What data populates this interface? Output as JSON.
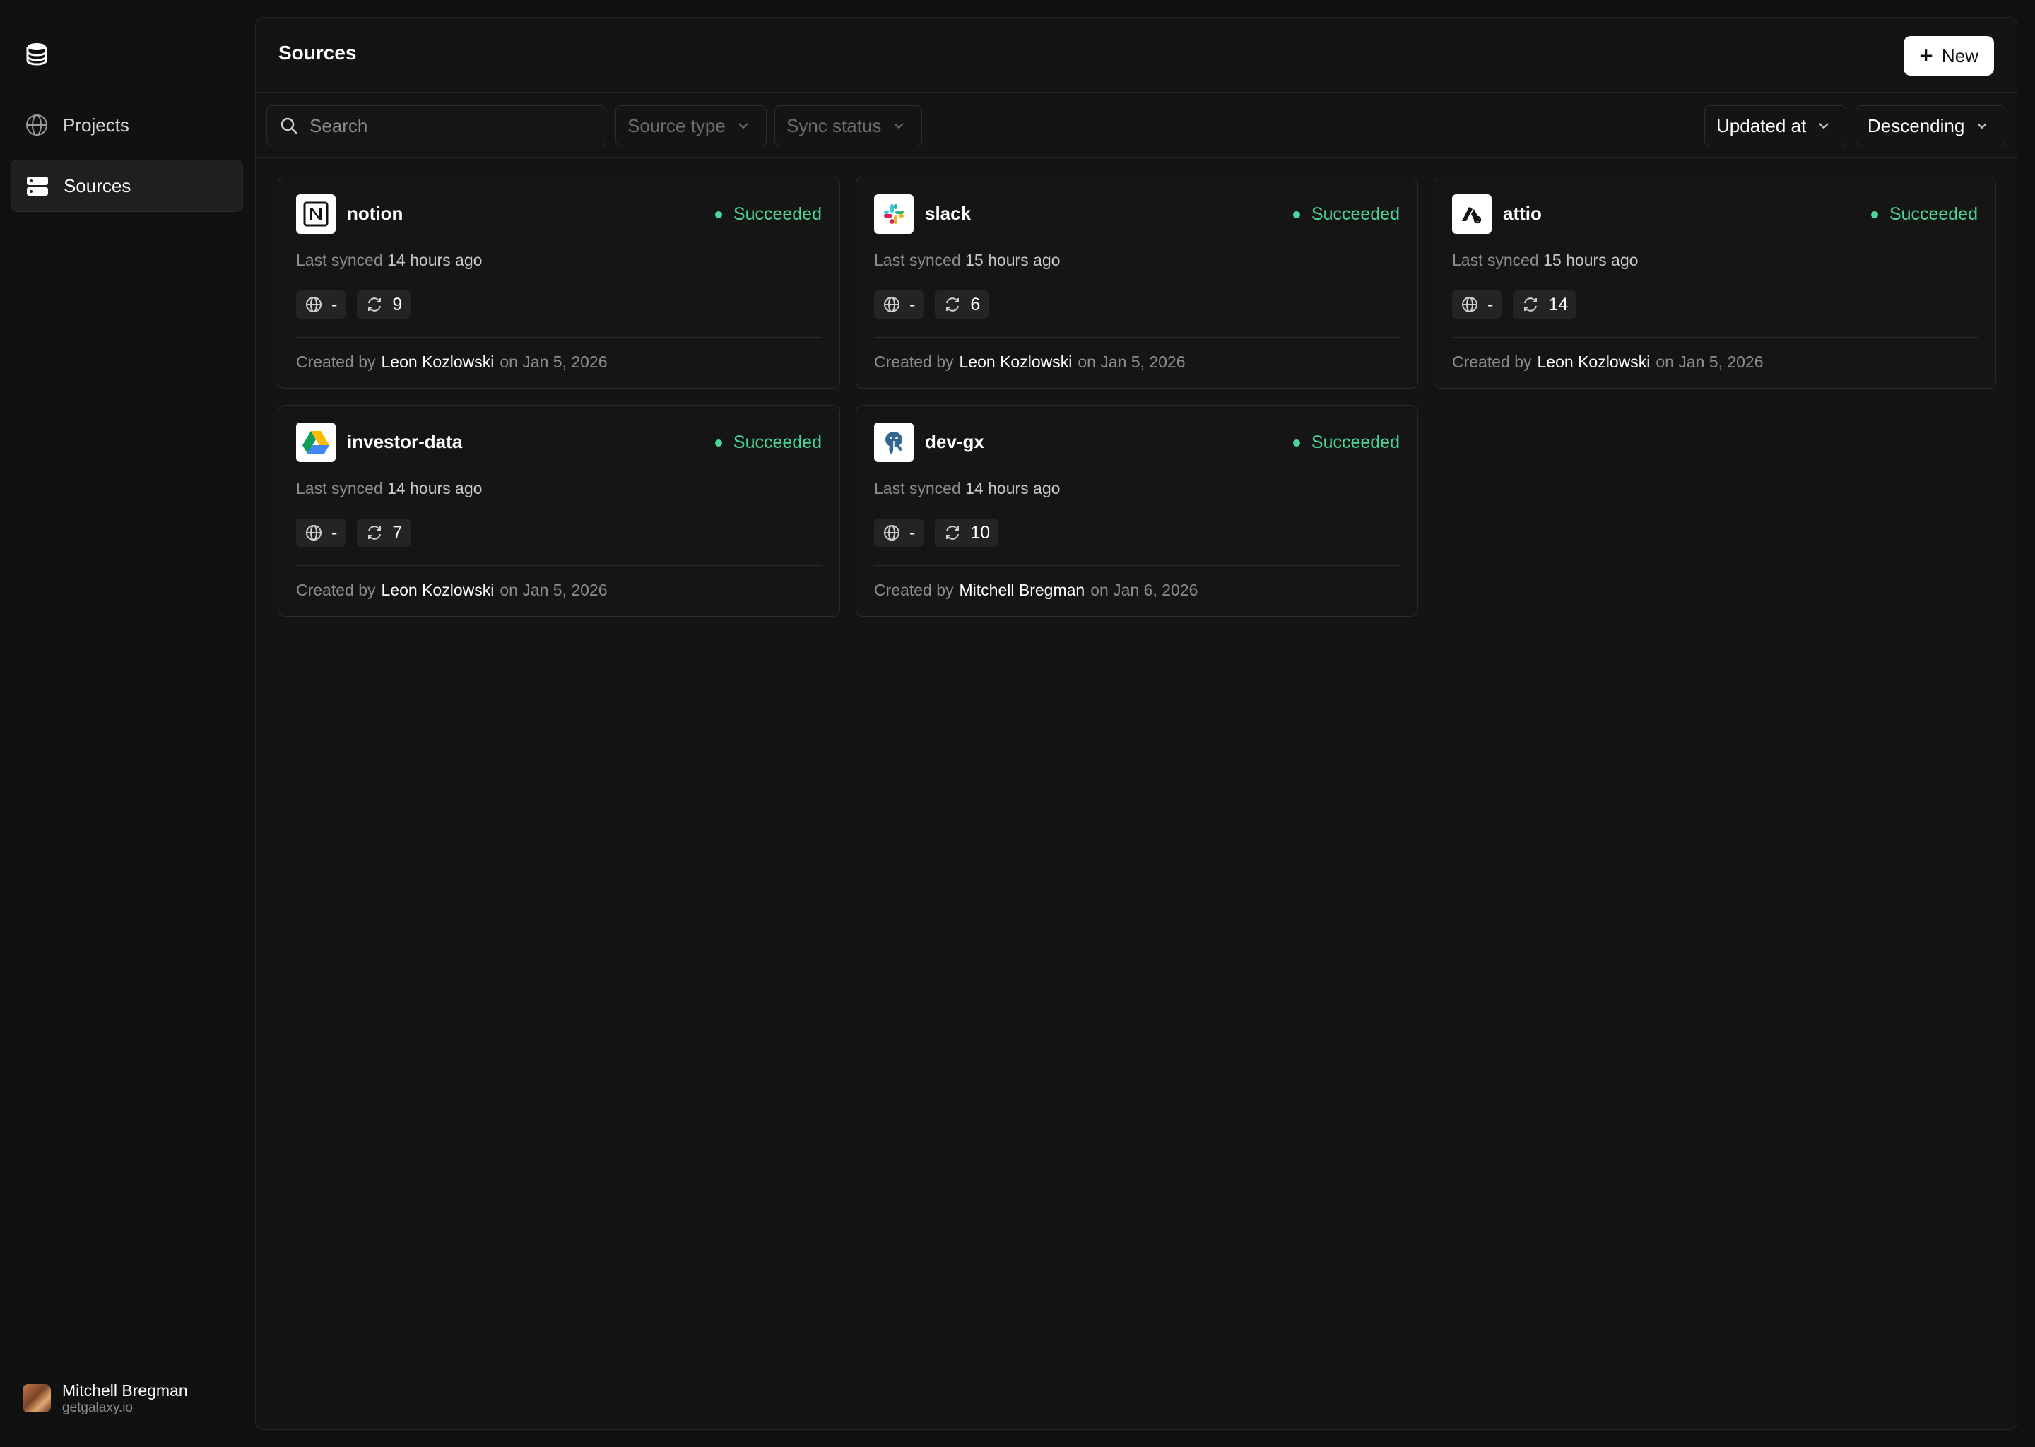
{
  "sidebar": {
    "logo_icon": "database-icon",
    "items": [
      {
        "label": "Projects",
        "icon": "globe-icon",
        "active": false
      },
      {
        "label": "Sources",
        "icon": "server-icon",
        "active": true
      }
    ],
    "user": {
      "name": "Mitchell Bregman",
      "org": "getgalaxy.io"
    }
  },
  "header": {
    "title": "Sources",
    "new_label": "New"
  },
  "filters": {
    "search_placeholder": "Search",
    "source_type": "Source type",
    "sync_status": "Sync status",
    "sort_by": "Updated at",
    "sort_order": "Descending"
  },
  "colors": {
    "success": "#4cd79a",
    "background": "#111111",
    "panel": "#141414"
  },
  "cards": [
    {
      "name": "notion",
      "logo": "notion-icon",
      "status": "Succeeded",
      "synced_prefix": "Last synced",
      "synced_ago": "14 hours ago",
      "projects": "-",
      "syncs": "9",
      "created_prefix": "Created by",
      "creator": "Leon Kozlowski",
      "created_on": "on Jan 5, 2026"
    },
    {
      "name": "slack",
      "logo": "slack-icon",
      "status": "Succeeded",
      "synced_prefix": "Last synced",
      "synced_ago": "15 hours ago",
      "projects": "-",
      "syncs": "6",
      "created_prefix": "Created by",
      "creator": "Leon Kozlowski",
      "created_on": "on Jan 5, 2026"
    },
    {
      "name": "attio",
      "logo": "attio-icon",
      "status": "Succeeded",
      "synced_prefix": "Last synced",
      "synced_ago": "15 hours ago",
      "projects": "-",
      "syncs": "14",
      "created_prefix": "Created by",
      "creator": "Leon Kozlowski",
      "created_on": "on Jan 5, 2026"
    },
    {
      "name": "investor-data",
      "logo": "google-drive-icon",
      "status": "Succeeded",
      "synced_prefix": "Last synced",
      "synced_ago": "14 hours ago",
      "projects": "-",
      "syncs": "7",
      "created_prefix": "Created by",
      "creator": "Leon Kozlowski",
      "created_on": "on Jan 5, 2026"
    },
    {
      "name": "dev-gx",
      "logo": "postgres-icon",
      "status": "Succeeded",
      "synced_prefix": "Last synced",
      "synced_ago": "14 hours ago",
      "projects": "-",
      "syncs": "10",
      "created_prefix": "Created by",
      "creator": "Mitchell Bregman",
      "created_on": "on Jan 6, 2026"
    }
  ]
}
